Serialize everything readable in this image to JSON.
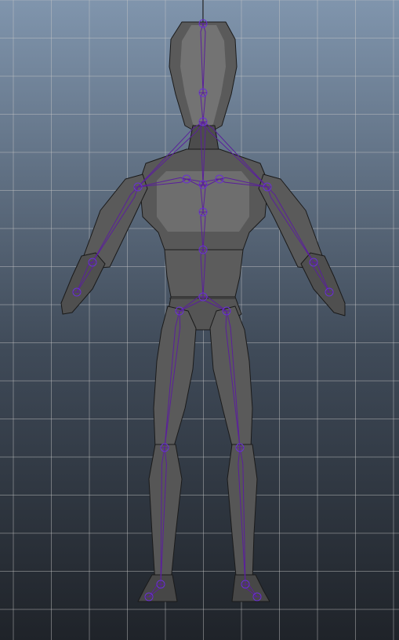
{
  "viewport": {
    "background_top": "#8095ad",
    "background_bottom": "#1f2329",
    "grid_color": "#c8c8c8",
    "axis_color": "#000000",
    "mesh_fill_light": "#707070",
    "mesh_fill_mid": "#555555",
    "mesh_fill_dark": "#2f2f2f",
    "mesh_edge": "#1a1a1a",
    "joint_color": "#6a2fd6",
    "bone_color": "#5a1f9c"
  }
}
